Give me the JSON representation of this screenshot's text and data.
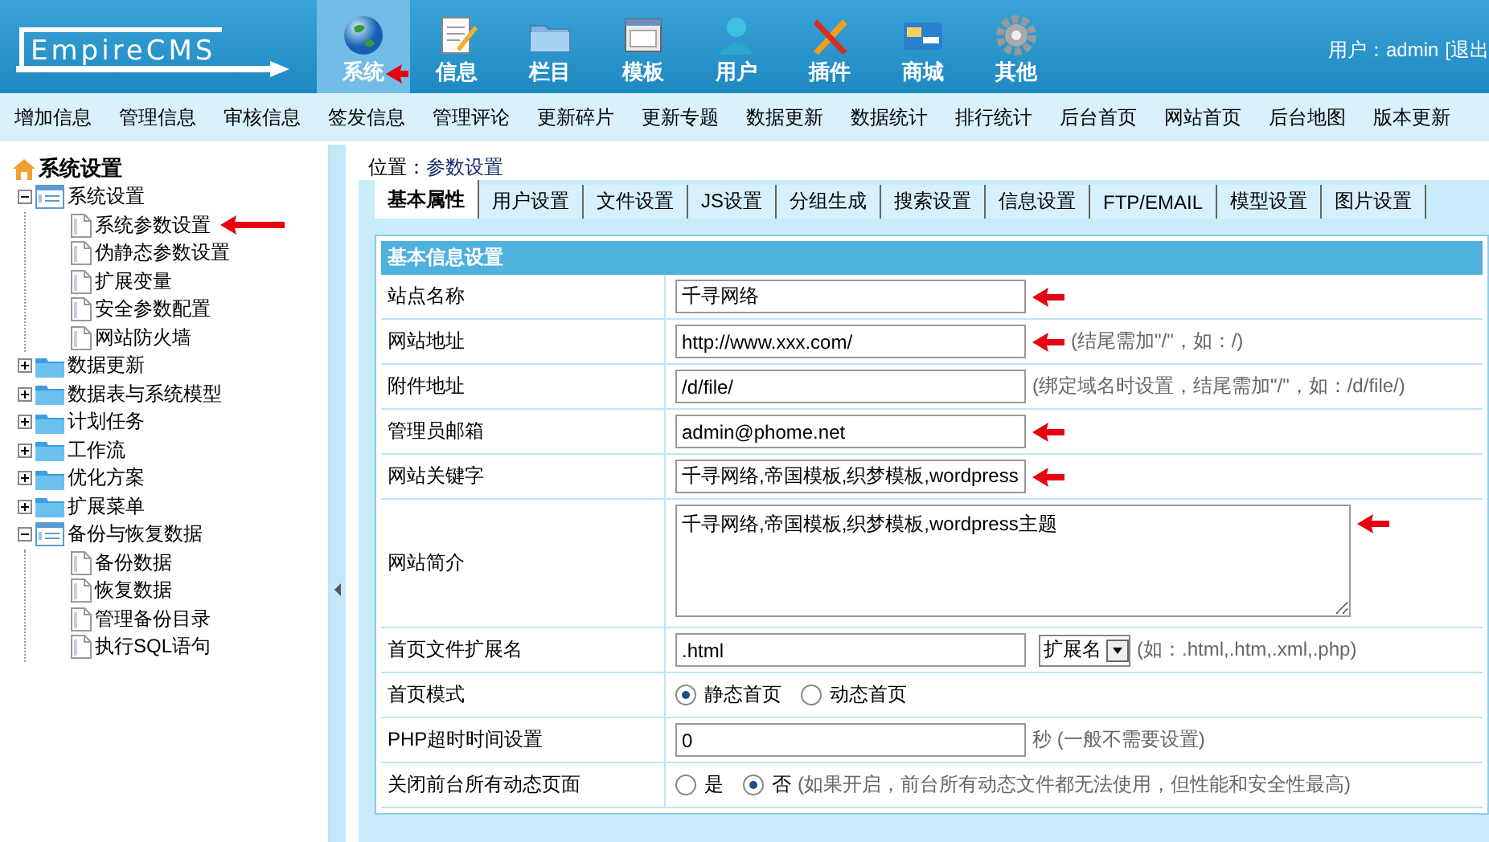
{
  "header": {
    "logo": "EmpireCMS",
    "nav_items": [
      {
        "label": "系统",
        "selected": true,
        "marked": true
      },
      {
        "label": "信息",
        "selected": false,
        "marked": false
      },
      {
        "label": "栏目",
        "selected": false,
        "marked": false
      },
      {
        "label": "模板",
        "selected": false,
        "marked": false
      },
      {
        "label": "用户",
        "selected": false,
        "marked": false
      },
      {
        "label": "插件",
        "selected": false,
        "marked": false
      },
      {
        "label": "商城",
        "selected": false,
        "marked": false
      },
      {
        "label": "其他",
        "selected": false,
        "marked": false
      }
    ],
    "user": "用户：admin",
    "logout": "[退出"
  },
  "submenu": [
    "增加信息",
    "管理信息",
    "审核信息",
    "签发信息",
    "管理评论",
    "更新碎片",
    "更新专题",
    "数据更新",
    "数据统计",
    "排行统计",
    "后台首页",
    "网站首页",
    "后台地图",
    "版本更新"
  ],
  "sidebar": {
    "title": "系统设置",
    "tree": [
      {
        "label": "系统设置",
        "expanded": true,
        "children": [
          {
            "label": "系统参数设置",
            "marked": true
          },
          {
            "label": "伪静态参数设置",
            "marked": false
          },
          {
            "label": "扩展变量",
            "marked": false
          },
          {
            "label": "安全参数配置",
            "marked": false
          },
          {
            "label": "网站防火墙",
            "marked": false
          }
        ]
      },
      {
        "label": "数据更新",
        "expanded": false
      },
      {
        "label": "数据表与系统模型",
        "expanded": false
      },
      {
        "label": "计划任务",
        "expanded": false
      },
      {
        "label": "工作流",
        "expanded": false
      },
      {
        "label": "优化方案",
        "expanded": false
      },
      {
        "label": "扩展菜单",
        "expanded": false
      },
      {
        "label": "备份与恢复数据",
        "expanded": true,
        "children": [
          {
            "label": "备份数据",
            "marked": false
          },
          {
            "label": "恢复数据",
            "marked": false
          },
          {
            "label": "管理备份目录",
            "marked": false
          },
          {
            "label": "执行SQL语句",
            "marked": false
          }
        ]
      }
    ]
  },
  "breadcrumb": {
    "label": "位置：",
    "value": "参数设置"
  },
  "tabs": [
    {
      "label": "基本属性",
      "selected": true
    },
    {
      "label": "用户设置",
      "selected": false
    },
    {
      "label": "文件设置",
      "selected": false
    },
    {
      "label": "JS设置",
      "selected": false
    },
    {
      "label": "分组生成",
      "selected": false
    },
    {
      "label": "搜索设置",
      "selected": false
    },
    {
      "label": "信息设置",
      "selected": false
    },
    {
      "label": "FTP/EMAIL",
      "selected": false
    },
    {
      "label": "模型设置",
      "selected": false
    },
    {
      "label": "图片设置",
      "selected": false
    }
  ],
  "panel": {
    "title": "基本信息设置",
    "rows": [
      {
        "kind": "text",
        "label": "站点名称",
        "value": "千寻网络",
        "marked": true
      },
      {
        "kind": "text",
        "label": "网站地址",
        "value": "http://www.xxx.com/",
        "hint": "(结尾需加\"/\"，如：/)",
        "marked": true
      },
      {
        "kind": "text",
        "label": "附件地址",
        "value": "/d/file/",
        "hint": "(绑定域名时设置，结尾需加\"/\"，如：/d/file/)",
        "marked": false
      },
      {
        "kind": "text",
        "label": "管理员邮箱",
        "value": "admin@phome.net",
        "marked": true
      },
      {
        "kind": "text",
        "label": "网站关键字",
        "value": "千寻网络,帝国模板,织梦模板,wordpress",
        "marked": true
      },
      {
        "kind": "textarea",
        "label": "网站简介",
        "value": "千寻网络,帝国模板,织梦模板,wordpress主题",
        "marked": true
      },
      {
        "kind": "select",
        "label": "首页文件扩展名",
        "value": ".html",
        "select": "扩展名",
        "hint": "(如：.html,.htm,.xml,.php)",
        "marked": false
      },
      {
        "kind": "radio",
        "label": "首页模式",
        "options": [
          {
            "label": "静态首页",
            "selected": true
          },
          {
            "label": "动态首页",
            "selected": false
          }
        ]
      },
      {
        "kind": "text",
        "label": "PHP超时时间设置",
        "value": "0",
        "hint": "秒 (一般不需要设置)",
        "marked": false
      },
      {
        "kind": "radio",
        "label": "关闭前台所有动态页面",
        "options": [
          {
            "label": "是",
            "selected": false
          },
          {
            "label": "否",
            "selected": true
          }
        ],
        "hint": "(如果开启，前台所有动态文件都无法使用，但性能和安全性最高)"
      }
    ]
  }
}
